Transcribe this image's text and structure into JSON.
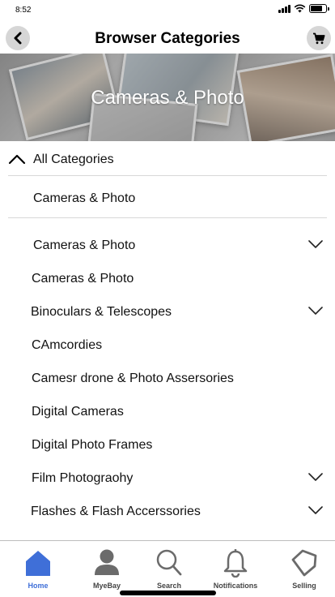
{
  "status_bar": {
    "time": "8:52",
    "battery_level": 0.85
  },
  "header": {
    "title": "Browser Categories"
  },
  "banner": {
    "title": "Cameras & Photo"
  },
  "tree": {
    "root_label": "All Categories",
    "parent_label": "Cameras & Photo"
  },
  "categories": [
    {
      "label": "Cameras & Photo",
      "expandable": true
    },
    {
      "label": "Cameras & Photo",
      "expandable": false
    },
    {
      "label": "Binoculars & Telescopes",
      "expandable": true
    },
    {
      "label": "CAmcordies",
      "expandable": false
    },
    {
      "label": "Camesr drone & Photo Assersories",
      "expandable": false
    },
    {
      "label": "Digital Cameras",
      "expandable": false
    },
    {
      "label": "Digital Photo Frames",
      "expandable": false
    },
    {
      "label": "Film Photograohy",
      "expandable": true
    },
    {
      "label": "Flashes & Flash Accerssories",
      "expandable": true
    }
  ],
  "tabs": [
    {
      "label": "Home",
      "icon": "home-icon",
      "active": true
    },
    {
      "label": "MyeBay",
      "icon": "user-icon",
      "active": false
    },
    {
      "label": "Search",
      "icon": "search-icon",
      "active": false
    },
    {
      "label": "Notifications",
      "icon": "bell-icon",
      "active": false
    },
    {
      "label": "Selling",
      "icon": "tag-icon",
      "active": false
    }
  ],
  "colors": {
    "accent": "#3f6fd8",
    "icon_gray": "#6b6b6b",
    "button_bg": "#d6d6d6",
    "divider": "#d8d8d8"
  }
}
